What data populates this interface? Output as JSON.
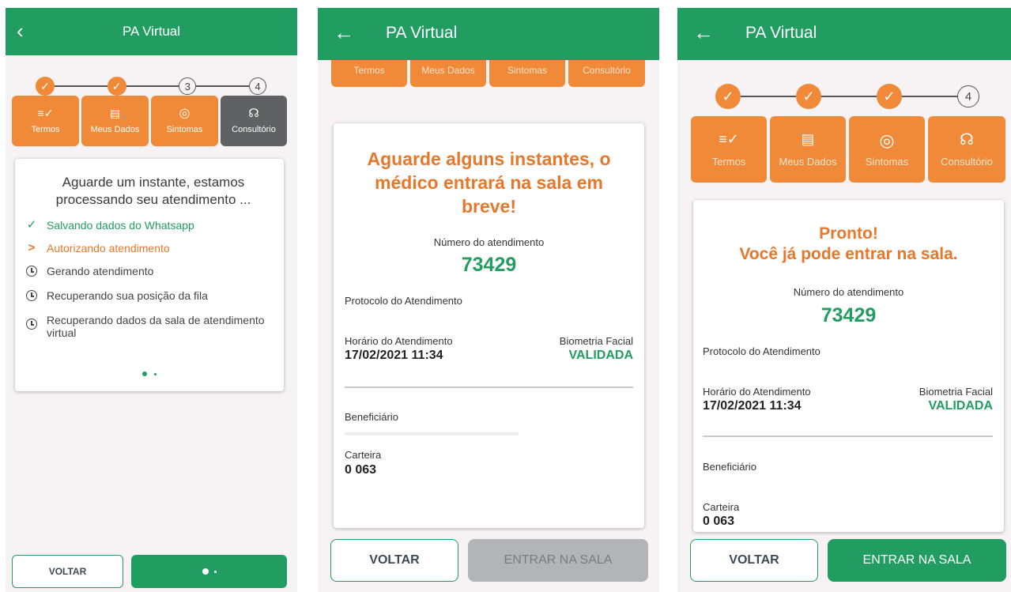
{
  "screen1": {
    "title": "PA Virtual",
    "steps": [
      "",
      "",
      "3",
      "4"
    ],
    "tabs": [
      {
        "label": "Termos",
        "icon": "≡✓"
      },
      {
        "label": "Meus Dados",
        "icon": "▤"
      },
      {
        "label": "Sintomas",
        "icon": "◎"
      },
      {
        "label": "Consultório",
        "icon": "☊"
      }
    ],
    "message": "Aguarde um instante, estamos processando seu atendimento ...",
    "status_items": [
      {
        "text": "Salvando dados do Whatsapp",
        "state": "done"
      },
      {
        "text": "Autorizando atendimento",
        "state": "in-progress"
      },
      {
        "text": "Gerando atendimento",
        "state": "pending"
      },
      {
        "text": "Recuperando sua posição da fila",
        "state": "pending"
      },
      {
        "text": "Recuperando dados da sala de atendimento virtual",
        "state": "pending"
      }
    ],
    "back_button": "VOLTAR"
  },
  "screen2": {
    "title": "PA Virtual",
    "tabs": [
      "Termos",
      "Meus Dados",
      "Sintomas",
      "Consultório"
    ],
    "heading": "Aguarde alguns instantes, o médico entrará na sala em breve!",
    "number_label": "Número do atendimento",
    "number_value": "73429",
    "protocol_label": "Protocolo do Atendimento",
    "time_label": "Horário do Atendimento",
    "time_value": "17/02/2021 11:34",
    "biometry_label": "Biometria Facial",
    "biometry_value": "VALIDADA",
    "beneficiary_label": "Beneficiário",
    "wallet_label": "Carteira",
    "wallet_value": "0 063",
    "back_button": "VOLTAR",
    "enter_button": "ENTRAR NA SALA"
  },
  "screen3": {
    "title": "PA Virtual",
    "steps": [
      "",
      "",
      "",
      "4"
    ],
    "tabs": [
      {
        "label": "Termos",
        "icon": "≡✓"
      },
      {
        "label": "Meus Dados",
        "icon": "▤"
      },
      {
        "label": "Sintomas",
        "icon": "◎"
      },
      {
        "label": "Consultório",
        "icon": "☊"
      }
    ],
    "heading_line1": "Pronto!",
    "heading_line2": "Você já pode entrar na sala.",
    "number_label": "Número do atendimento",
    "number_value": "73429",
    "protocol_label": "Protocolo do Atendimento",
    "time_label": "Horário do Atendimento",
    "time_value": "17/02/2021 11:34",
    "biometry_label": "Biometria Facial",
    "biometry_value": "VALIDADA",
    "beneficiary_label": "Beneficiário",
    "wallet_label": "Carteira",
    "wallet_value": "0 063",
    "back_button": "VOLTAR",
    "enter_button": "ENTRAR NA SALA"
  },
  "colors": {
    "brand_green": "#229d62",
    "accent_orange": "#f08a38",
    "disabled_grey": "#b3b4b5"
  }
}
